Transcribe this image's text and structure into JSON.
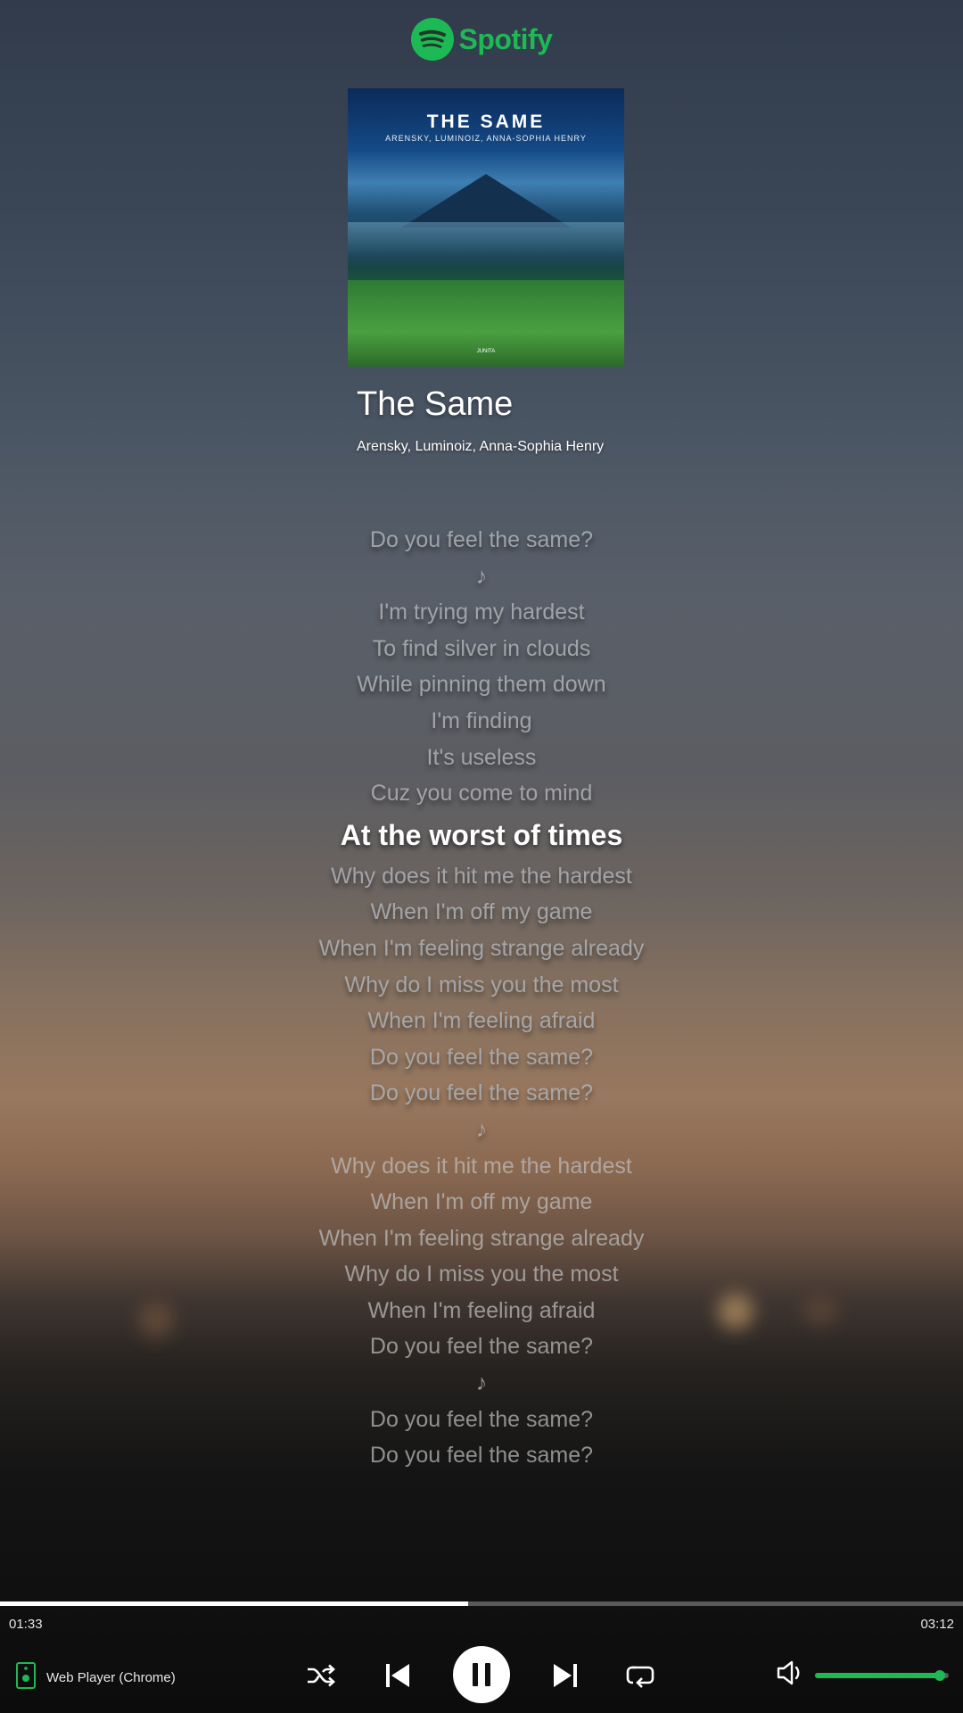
{
  "app": {
    "name": "Spotify",
    "brand_color": "#1db954"
  },
  "album_cover": {
    "title": "THE SAME",
    "artists": "ARENSKY, LUMINOIZ, ANNA-SOPHIA HENRY",
    "label": "JUNITA"
  },
  "track": {
    "title": "The Same",
    "artists": "Arensky, Luminoiz, Anna-Sophia Henry"
  },
  "lyrics": {
    "active_index": 8,
    "lines": [
      "Do you feel the same?",
      "♪",
      "I'm trying my hardest",
      "To find silver in clouds",
      "While pinning them down",
      "I'm finding",
      "It's useless",
      "Cuz you come to mind",
      "At the worst of times",
      "Why does it hit me the hardest",
      "When I'm off my game",
      "When I'm feeling strange already",
      "Why do I miss you the most",
      "When I'm feeling afraid",
      "Do you feel the same?",
      "Do you feel the same?",
      "♪",
      "Why does it hit me the hardest",
      "When I'm off my game",
      "When I'm feeling strange already",
      "Why do I miss you the most",
      "When I'm feeling afraid",
      "Do you feel the same?",
      "♪",
      "Do you feel the same?",
      "Do you feel the same?"
    ]
  },
  "playback": {
    "elapsed": "01:33",
    "total": "03:12",
    "progress_fraction": 0.486,
    "state": "playing",
    "volume_fraction": 0.93
  },
  "device": {
    "label": "Web Player (Chrome)",
    "icon": "speaker-device-icon"
  },
  "controls": {
    "shuffle_icon": "shuffle-icon",
    "previous_icon": "skip-previous-icon",
    "play_pause_icon": "pause-icon",
    "next_icon": "skip-next-icon",
    "repeat_icon": "repeat-icon",
    "volume_icon": "volume-icon"
  }
}
